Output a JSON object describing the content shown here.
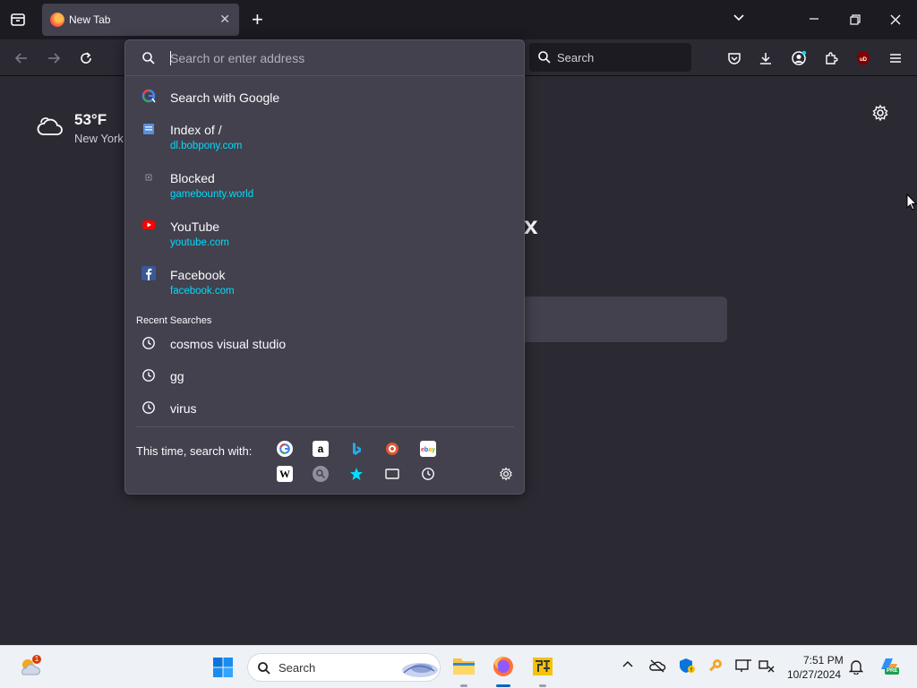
{
  "tab": {
    "title": "New Tab",
    "close": "✕"
  },
  "tabstrip": {
    "new_tab": "+",
    "list_all": "⌄",
    "min": "—",
    "max": "❐",
    "close": "✕"
  },
  "toolbar": {
    "search_label": "Search"
  },
  "weather": {
    "temp": "53°F",
    "city": "New York"
  },
  "logo_fragment": "x",
  "urlbar": {
    "placeholder": "Search or enter address",
    "results": [
      {
        "title": "Search with Google",
        "url": ""
      },
      {
        "title": "Index of /",
        "url": "dl.bobpony.com"
      },
      {
        "title": "Blocked",
        "url": "gamebounty.world"
      },
      {
        "title": "YouTube",
        "url": "youtube.com"
      },
      {
        "title": "Facebook",
        "url": "facebook.com"
      }
    ],
    "recent_header": "Recent Searches",
    "recent": [
      "cosmos visual studio",
      "gg",
      "virus"
    ],
    "search_with_label": "This time, search with:",
    "engines": [
      "google",
      "amazon",
      "bing",
      "duckduckgo",
      "ebay",
      "wikipedia",
      "search-addon",
      "bookmarks",
      "tabs",
      "history"
    ]
  },
  "taskbar": {
    "search_label": "Search",
    "time": "7:51 PM",
    "date": "10/27/2024",
    "weather_badge": "1",
    "copilot_badge": "PRE"
  },
  "colors": {
    "accent": "#00ddff",
    "panel": "#42414d",
    "bg": "#2b2a33"
  }
}
